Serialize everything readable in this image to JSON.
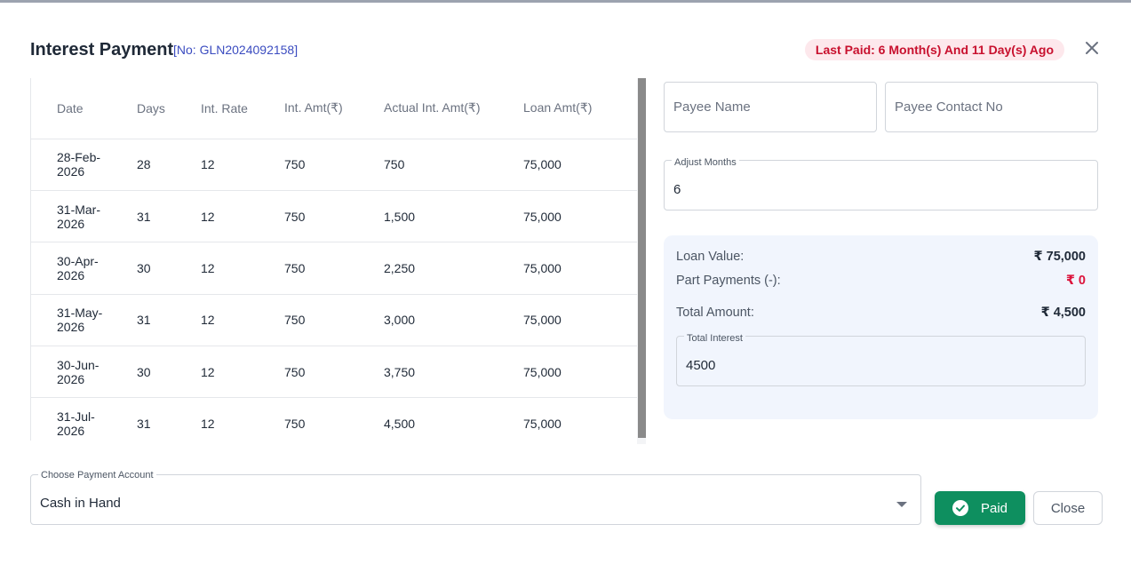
{
  "dialog": {
    "title": "Interest Payment",
    "ref": "[No: GLN2024092158]",
    "last_paid": "Last Paid: 6 Month(s) And 11 Day(s) Ago"
  },
  "table": {
    "headers": [
      "Date",
      "Days",
      "Int. Rate",
      "Int. Amt(₹)",
      "Actual Int. Amt(₹)",
      "Loan Amt(₹)"
    ],
    "rows": [
      {
        "date": "28-Feb-2026",
        "days": "28",
        "rate": "12",
        "int_amt": "750",
        "actual": "750",
        "loan": "75,000"
      },
      {
        "date": "31-Mar-2026",
        "days": "31",
        "rate": "12",
        "int_amt": "750",
        "actual": "1,500",
        "loan": "75,000"
      },
      {
        "date": "30-Apr-2026",
        "days": "30",
        "rate": "12",
        "int_amt": "750",
        "actual": "2,250",
        "loan": "75,000"
      },
      {
        "date": "31-May-2026",
        "days": "31",
        "rate": "12",
        "int_amt": "750",
        "actual": "3,000",
        "loan": "75,000"
      },
      {
        "date": "30-Jun-2026",
        "days": "30",
        "rate": "12",
        "int_amt": "750",
        "actual": "3,750",
        "loan": "75,000"
      },
      {
        "date": "31-Jul-2026",
        "days": "31",
        "rate": "12",
        "int_amt": "750",
        "actual": "4,500",
        "loan": "75,000"
      }
    ]
  },
  "form": {
    "payee_name_placeholder": "Payee Name",
    "payee_contact_placeholder": "Payee Contact No",
    "adjust_months_label": "Adjust Months",
    "adjust_months_value": "6"
  },
  "summary": {
    "loan_value_label": "Loan Value:",
    "loan_value": "₹ 75,000",
    "part_payments_label": "Part Payments (-):",
    "part_payments": "₹ 0",
    "total_amount_label": "Total Amount:",
    "total_amount": "₹ 4,500",
    "total_interest_label": "Total Interest",
    "total_interest_value": "4500"
  },
  "payment": {
    "account_label": "Choose Payment Account",
    "account_value": "Cash in Hand"
  },
  "buttons": {
    "paid": "Paid",
    "close": "Close"
  },
  "colors": {
    "paid_button": "#0e8f5f",
    "badge_bg": "#fde8ec",
    "badge_text": "#c8102e",
    "summary_bg": "#f1f5fd"
  },
  "icons": {
    "close": "close-icon",
    "check": "check-circle-icon",
    "dropdown": "caret-down-icon"
  }
}
